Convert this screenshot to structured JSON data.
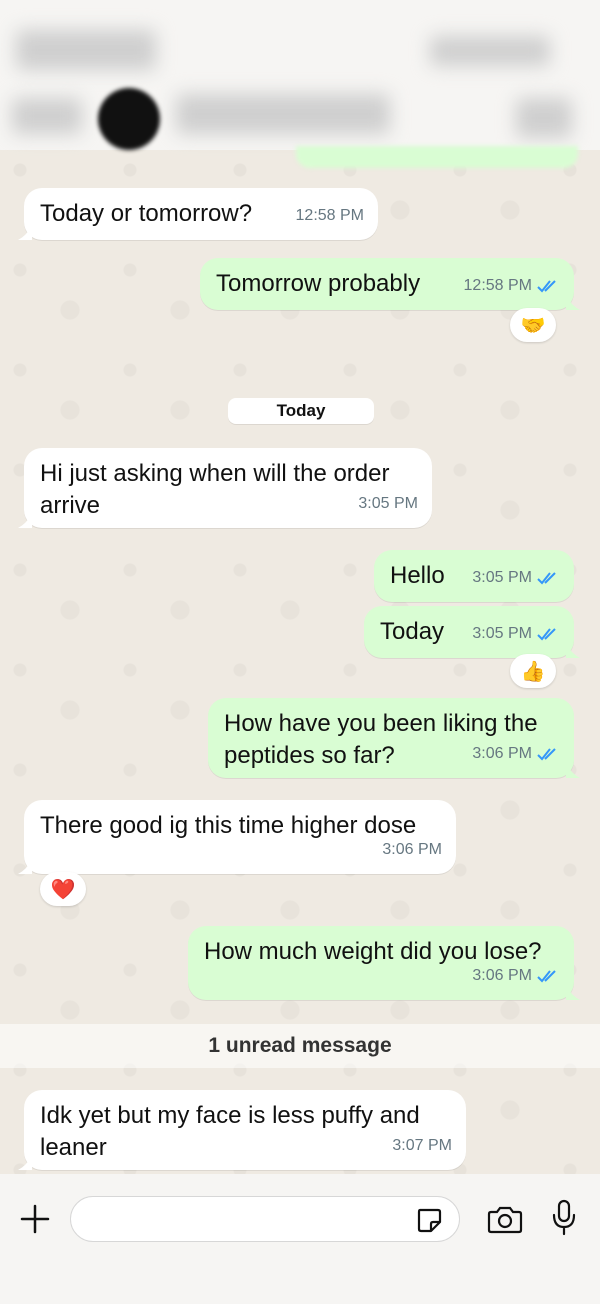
{
  "reactions": {
    "handshake": "🤝",
    "thumbs_up": "👍",
    "heart": "❤️"
  },
  "date_divider": "Today",
  "unread_banner": "1 unread message",
  "messages": [
    {
      "text": "Today or tomorrow?",
      "time": "12:58 PM",
      "direction": "in"
    },
    {
      "text": "Tomorrow probably",
      "time": "12:58 PM",
      "direction": "out",
      "read": true
    },
    {
      "text": "Hi just asking when will the order\narrive",
      "time": "3:05 PM",
      "direction": "in"
    },
    {
      "text": "Hello",
      "time": "3:05 PM",
      "direction": "out",
      "read": true
    },
    {
      "text": "Today",
      "time": "3:05 PM",
      "direction": "out",
      "read": true
    },
    {
      "text": "How have you been liking the\npeptides so far?",
      "time": "3:06 PM",
      "direction": "out",
      "read": true
    },
    {
      "text": "There good ig this time higher dose",
      "time": "3:06 PM",
      "direction": "in"
    },
    {
      "text": "How much weight did you lose?",
      "time": "3:06 PM",
      "direction": "out",
      "read": true
    },
    {
      "text": "Idk yet but my face is less puffy and\nleaner",
      "time": "3:07 PM",
      "direction": "in"
    }
  ],
  "composer": {
    "placeholder": ""
  },
  "colors": {
    "incoming": "#ffffff",
    "outgoing": "#d9fdd3",
    "read_tick": "#3497f9",
    "background": "#efeae2"
  }
}
